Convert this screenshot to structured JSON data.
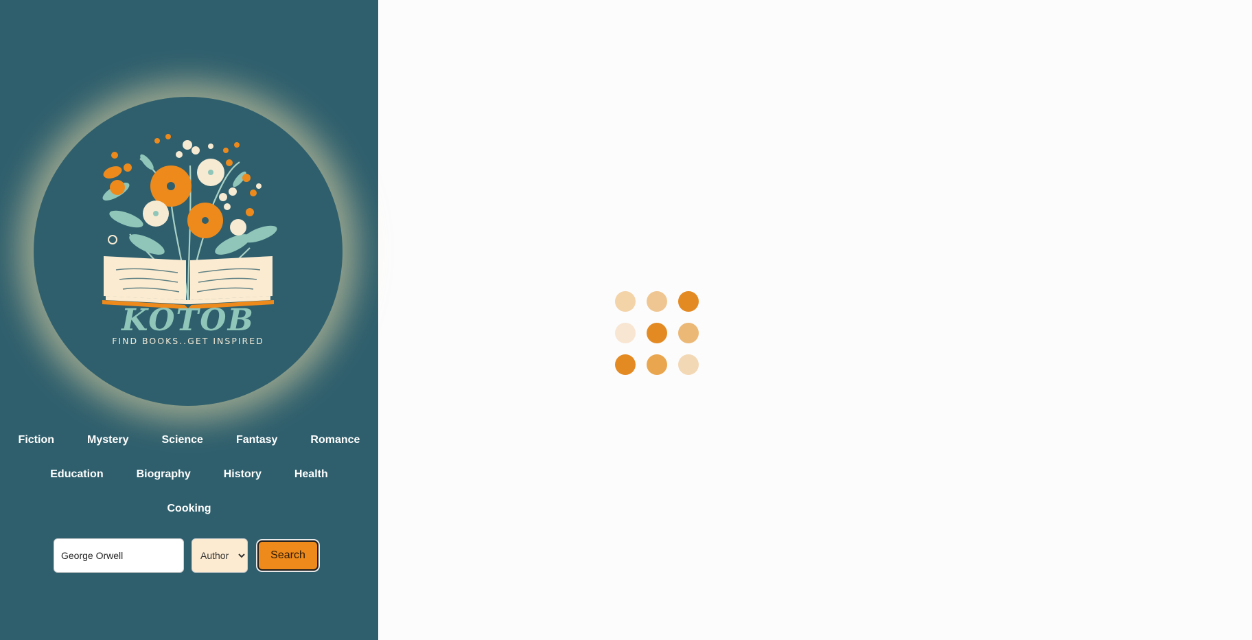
{
  "brand": {
    "name": "KOTOB",
    "tagline": "FIND BOOKS..GET INSPIRED"
  },
  "genres": [
    "Fiction",
    "Mystery",
    "Science",
    "Fantasy",
    "Romance",
    "Education",
    "Biography",
    "History",
    "Health",
    "Cooking"
  ],
  "search": {
    "value": "George Orwell",
    "type_selected": "Author",
    "button_label": "Search"
  },
  "colors": {
    "sidebar_bg": "#2f5f6d",
    "accent": "#ee8a1c",
    "loader_dots": [
      "#f3d3a8",
      "#efc691",
      "#e48a23",
      "#f8e6d3",
      "#e48a23",
      "#ecb876",
      "#e48a23",
      "#eaa64f",
      "#f3d8b6"
    ]
  },
  "icons": {
    "logo": "open-book-flowers-icon",
    "select_caret": "chevron-down-icon",
    "loader": "loading-dots-icon"
  }
}
